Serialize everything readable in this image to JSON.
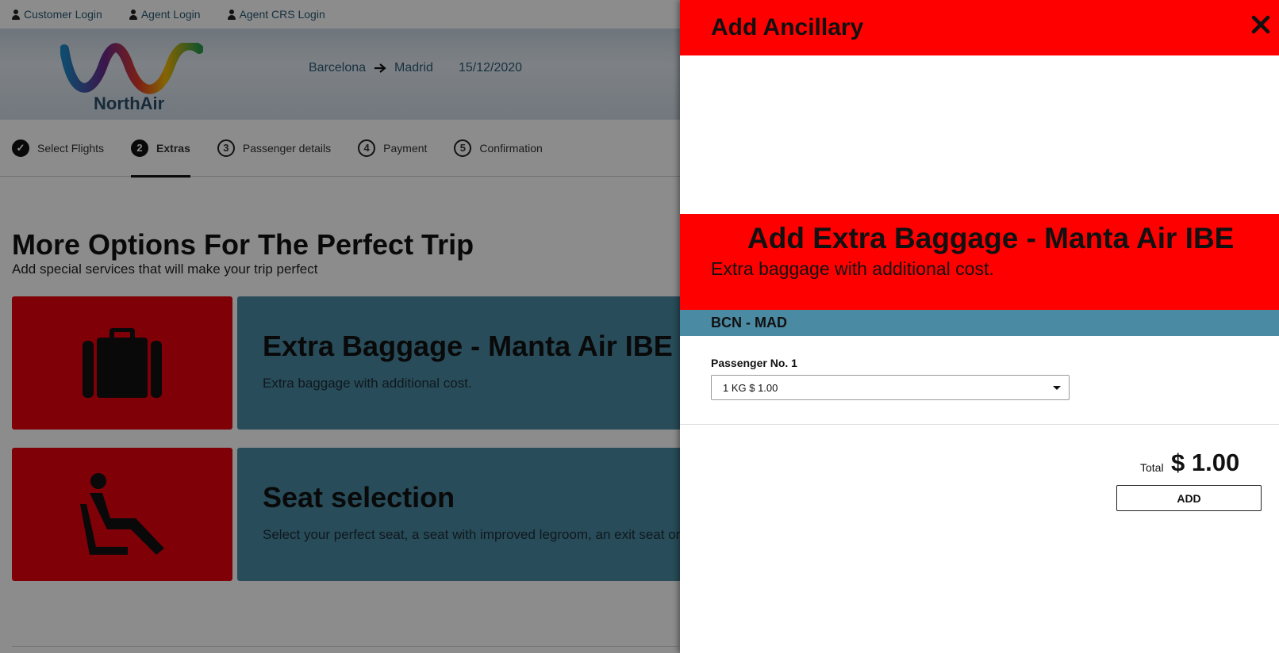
{
  "topbar": {
    "links": [
      {
        "label": "Customer Login",
        "icon": "person-icon"
      },
      {
        "label": "Agent Login",
        "icon": "person-icon"
      },
      {
        "label": "Agent CRS Login",
        "icon": "person-icon"
      }
    ]
  },
  "header": {
    "logo_text": "NorthAir",
    "origin": "Barcelona",
    "destination": "Madrid",
    "date": "15/12/2020"
  },
  "steps": [
    {
      "num": "✓",
      "label": "Select Flights",
      "state": "done"
    },
    {
      "num": "2",
      "label": "Extras",
      "state": "active"
    },
    {
      "num": "3",
      "label": "Passenger details",
      "state": "pending"
    },
    {
      "num": "4",
      "label": "Payment",
      "state": "pending"
    },
    {
      "num": "5",
      "label": "Confirmation",
      "state": "pending"
    }
  ],
  "main": {
    "title": "More Options For The Perfect Trip",
    "subtitle": "Add special services that will make your trip perfect",
    "cards": [
      {
        "icon": "baggage-icon",
        "title": "Extra Baggage - Manta Air IBE",
        "desc": "Extra baggage with additional cost."
      },
      {
        "icon": "seat-icon",
        "title": "Seat selection",
        "desc": "Select your perfect seat, a seat with improved legroom, an exit seat or"
      }
    ]
  },
  "panel": {
    "title": "Add Ancillary",
    "ancillary_title": "Add Extra Baggage - Manta Air IBE",
    "ancillary_desc": "Extra baggage with additional cost.",
    "route": "BCN - MAD",
    "passenger_label": "Passenger No. 1",
    "selected_option": "1 KG $ 1.00",
    "total_label": "Total",
    "total_value": "$ 1.00",
    "add_label": "ADD"
  },
  "colors": {
    "accent_red": "#ff0000",
    "card_teal": "#4a8aa3",
    "link_blue": "#2b5a74"
  }
}
